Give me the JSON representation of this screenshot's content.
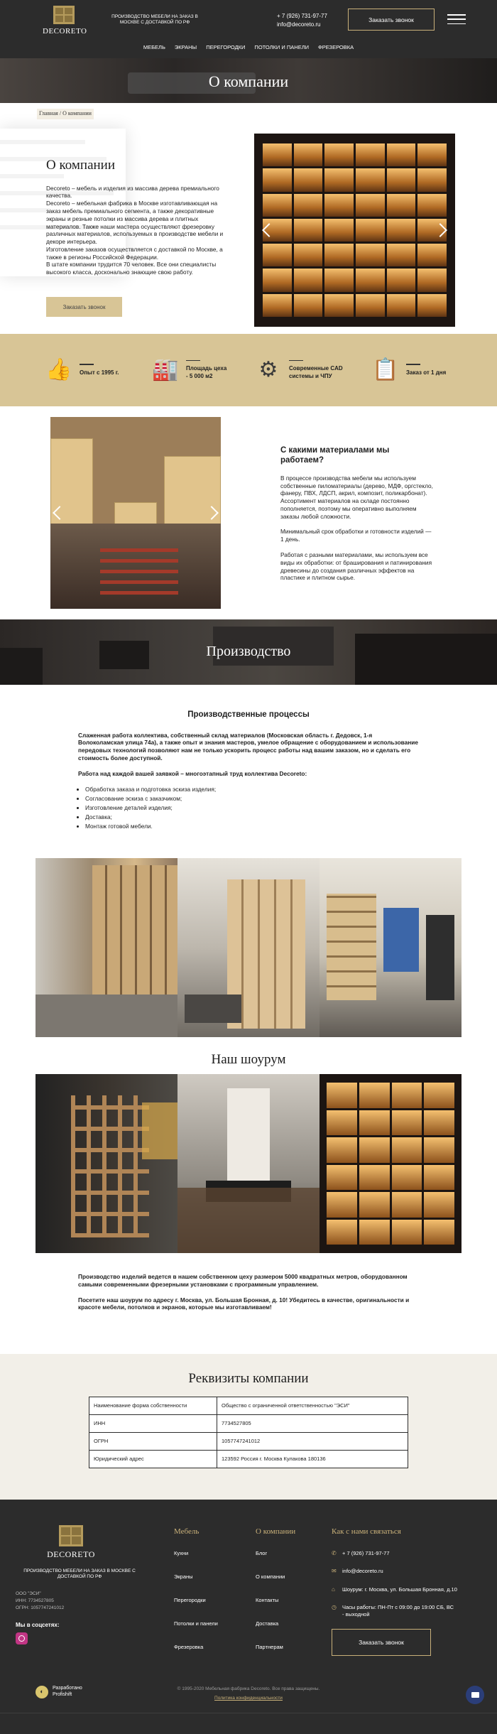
{
  "header": {
    "logo": "DECORETO",
    "tagline": "Производство мебели на заказ в Москве с доставкой по РФ",
    "phone": "+ 7 (926) 731-97-77",
    "email": "info@decoreto.ru",
    "call_button": "Заказать звонок",
    "nav": [
      "Мебель",
      "Экраны",
      "Перегородки",
      "Потолки и панели",
      "Фрезеровка"
    ]
  },
  "hero": {
    "title": "О компании"
  },
  "breadcrumb": {
    "home": "Главная",
    "separator": " / ",
    "current": "О компании"
  },
  "about": {
    "title": "О компании",
    "paragraphs": [
      "Decoreto – мебель и изделия из массива дерева премиального качества.",
      "Decoreto – мебельная фабрика в Москве изготавливающая на заказ мебель премиального сегмента, а также декоративные экраны и резные потолки из массива дерева и плитных материалов. Также наши мастера осуществляют фрезеровку различных материалов, используемых в производстве мебели и декоре интерьера.",
      "Изготовление заказов осуществляется с доставкой по Москве, а также в регионы Российской Федерации.",
      "В штате компании трудится 70 человек. Все они специалисты высокого класса, досконально знающие свою работу."
    ],
    "order_button": "Заказать звонок"
  },
  "features": [
    {
      "icon": "thumbs-up-icon",
      "glyph": "👍",
      "text": "Опыт с 1995 г."
    },
    {
      "icon": "factory-icon",
      "glyph": "🏭",
      "text": "Площадь цеха - 5 000 м2"
    },
    {
      "icon": "gears-icon",
      "glyph": "⚙",
      "text": "Современные CAD системы и ЧПУ"
    },
    {
      "icon": "checklist-icon",
      "glyph": "📋",
      "text": "Заказ от 1 дня"
    }
  ],
  "materials": {
    "title": "С какими материалами мы работаем?",
    "paragraphs": [
      "В процессе производства мебели мы используем собственные пиломатериалы (дерево, МДФ, оргстекло, фанеру, ПВХ, ЛДСП, акрил, композит, поликарбонат). Ассортимент материалов на складе постоянно пополняется, поэтому мы оперативно выполняем заказы любой сложности.",
      "Минимальный срок обработки и готовности изделий — 1 день.",
      "Работая с разными материалами, мы используем все виды их обработки: от браширования и патинирования древесины до создания различных эффектов на пластике и плитном сырье."
    ]
  },
  "production": {
    "banner_title": "Производство",
    "title": "Производственные процессы",
    "paragraph1": "Слаженная работа коллектива, собственный склад материалов (Московская область г. Дедовск, 1-я Волоколамская улица 74а), а также опыт и знания мастеров, умелое обращение с оборудованием и использование передовых технологий позволяют нам не только ускорить процесс работы над вашим заказом, но и сделать его стоимость более доступной.",
    "paragraph2": "Работа над каждой вашей заявкой – многоэтапный труд коллектива Decoreto:",
    "steps": [
      "Обработка заказа и подготовка эскиза изделия;",
      "Согласование эскиза с заказчиком;",
      "Изготовление деталей изделия;",
      "Доставка;",
      "Монтаж готовой мебели."
    ]
  },
  "showroom": {
    "title": "Наш шоурум",
    "paragraph1": "Производство изделий ведется в нашем собственном цеху размером 5000 квадратных метров, оборудованном самыми современными фрезерными установками с программным управлением.",
    "paragraph2": "Посетите наш шоурум по адресу г. Москва, ул. Большая Бронная, д. 10! Убедитесь в качестве, оригинальности и красоте мебели, потолков и экранов, которые мы изготавливаем!"
  },
  "requisites": {
    "title": "Реквизиты компании",
    "rows": [
      [
        "Наименование форма собственности",
        "Общество с ограниченной ответственностью \"ЭСИ\""
      ],
      [
        "ИНН",
        "7734527805"
      ],
      [
        "ОГРН",
        "1057747241012"
      ],
      [
        "Юридический адрес",
        "123592 Россия г. Москва Кулакова 180136"
      ]
    ]
  },
  "footer": {
    "logo": "DECORETO",
    "tagline": "Производство мебели на заказ в Москве с доставкой по РФ",
    "legal": [
      "ООО \"ЭСИ\"",
      "ИНН: 7734527805",
      "ОГРН: 1057747241012"
    ],
    "social_label": "Мы в соцсетях:",
    "col_furniture_title": "Мебель",
    "col_furniture_links": [
      "Кухни",
      "Экраны",
      "Перегородки",
      "Потолки и панели",
      "Фрезеровка"
    ],
    "col_company_title": "О компании",
    "col_company_links": [
      "Блог",
      "О компании",
      "Контакты",
      "Доставка",
      "Партнерам"
    ],
    "contact_title": "Как с нами связаться",
    "phone": "+ 7 (926) 731-97-77",
    "email": "info@decoreto.ru",
    "address": "Шоурум: г. Москва, ул. Большая Бронная, д.10",
    "hours": "Часы работы: ПН-Пт с 09:00 до 19:00 СБ, ВС - выходной",
    "call_button": "Заказать звонок",
    "developer": "Разработано Profishift",
    "copyright": "© 1995-2020 Мебельная фабрика Decoreto. Все права защищены.",
    "policy": "Политика конфиденциальности"
  },
  "colors": {
    "accent": "#d8c596",
    "gold": "#c9b17a",
    "dark": "#2c2c2c"
  }
}
